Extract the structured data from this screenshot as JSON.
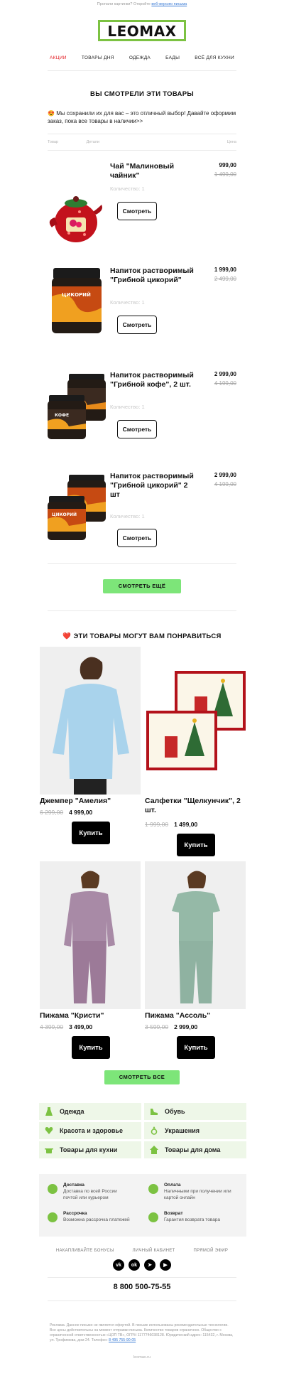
{
  "preheader": {
    "text": "Пропали картинки? Откройте",
    "link": "веб-версию письма"
  },
  "logo": "LEOMAX",
  "nav": [
    {
      "label": "АКЦИИ",
      "active": true
    },
    {
      "label": "ТОВАРЫ ДНЯ",
      "active": false
    },
    {
      "label": "ОДЕЖДА",
      "active": false
    },
    {
      "label": "БАДЫ",
      "active": false
    },
    {
      "label": "ВСЁ ДЛЯ КУХНИ",
      "active": false
    }
  ],
  "viewed": {
    "title": "ВЫ СМОТРЕЛИ ЭТИ ТОВАРЫ",
    "intro_emoji": "😍",
    "intro": "Мы сохранили их для вас – это отличный выбор! Давайте оформим заказ, пока все товары в наличии>>",
    "col_product": "Товар",
    "col_details": "Детали",
    "col_price": "Цена",
    "products": [
      {
        "name": "Чай \"Малиновый чайник\"",
        "qty": "Количество: 1",
        "price": "999,00",
        "old_price": "1 499,00",
        "button": "Смотреть"
      },
      {
        "name": "Напиток растворимый \"Грибной цикорий\"",
        "qty": "Количество: 1",
        "price": "1 999,00",
        "old_price": "2 499,00",
        "button": "Смотреть"
      },
      {
        "name": "Напиток растворимый \"Грибной кофе\", 2 шт.",
        "qty": "Количество: 1",
        "price": "2 999,00",
        "old_price": "4 199,00",
        "button": "Смотреть"
      },
      {
        "name": "Напиток растворимый \"Грибной цикорий\" 2 шт",
        "qty": "Количество: 1",
        "price": "2 999,00",
        "old_price": "4 199,00",
        "button": "Смотреть"
      }
    ],
    "more_button": "СМОТРЕТЬ ЕЩЁ"
  },
  "recommended": {
    "emoji": "❤️",
    "title": "ЭТИ ТОВАРЫ МОГУТ ВАМ ПОНРАВИТЬСЯ",
    "items": [
      {
        "name": "Джемпер \"Амелия\"",
        "old_price": "6 299,00",
        "price": "4 999,00",
        "button": "Купить"
      },
      {
        "name": "Салфетки \"Щелкунчик\", 2 шт.",
        "old_price": "1 999,00",
        "price": "1 499,00",
        "button": "Купить"
      },
      {
        "name": "Пижама \"Кристи\"",
        "old_price": "4 399,00",
        "price": "3 499,00",
        "button": "Купить"
      },
      {
        "name": "Пижама \"Ассоль\"",
        "old_price": "3 599,00",
        "price": "2 999,00",
        "button": "Купить"
      }
    ],
    "all_button": "СМОТРЕТЬ ВСЕ"
  },
  "categories": [
    {
      "label": "Одежда",
      "icon": "dress-icon"
    },
    {
      "label": "Обувь",
      "icon": "shoe-icon"
    },
    {
      "label": "Красота и здоровье",
      "icon": "heart-plus-icon"
    },
    {
      "label": "Украшения",
      "icon": "ring-icon"
    },
    {
      "label": "Товары для кухни",
      "icon": "pot-icon"
    },
    {
      "label": "Товары для дома",
      "icon": "house-icon"
    }
  ],
  "info": [
    {
      "title": "Доставка",
      "text": "Доставка по всей России почтой или курьером",
      "icon": "box-icon"
    },
    {
      "title": "Оплата",
      "text": "Наличными при получении или картой онлайн",
      "icon": "ruble-icon"
    },
    {
      "title": "Рассрочка",
      "text": "Возможна рассрочка платежей",
      "icon": "clock-icon"
    },
    {
      "title": "Возврат",
      "text": "Гарантия возврата товара",
      "icon": "return-icon"
    }
  ],
  "footer_links": [
    "НАКАПЛИВАЙТЕ БОНУСЫ",
    "ЛИЧНЫЙ КАБИНЕТ",
    "ПРЯМОЙ ЭФИР"
  ],
  "socials": [
    "vk-icon",
    "ok-icon",
    "telegram-icon",
    "youtube-icon"
  ],
  "phone": "8 800 500-75-55",
  "legal": "Реклама. Данное письмо не является офертой. В письме использованы рекомендательные технологии. Все цены действительны на момент отправки письма. Количество товаров ограничено. Общество с ограниченной ответственностью «ЦОП ТВ», ОГРН 1177746038128. Юридический адрес: 115432, г. Москва, ул. Трофимова, дом 24. Телефон:",
  "legal_phone": "8 495 755-90-05",
  "site": "leomax.ru",
  "colors": {
    "brand_green": "#7cc242",
    "button_green": "#7de579",
    "active_red": "#e31e24"
  }
}
